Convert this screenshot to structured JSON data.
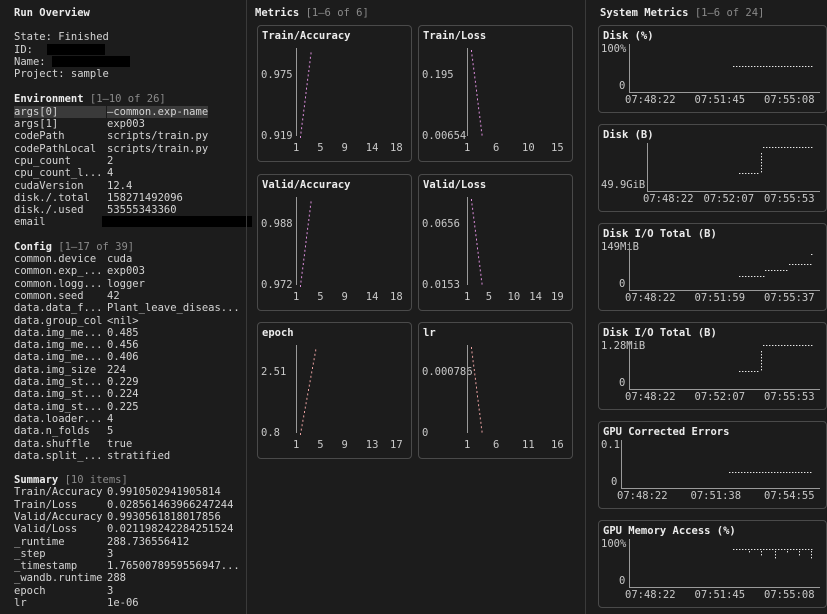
{
  "run_overview": {
    "title": "Run Overview",
    "state_label": "State:",
    "state_value": "Finished",
    "id_label": "ID:",
    "name_label": "Name:",
    "project_label": "Project:",
    "project_value": "sample"
  },
  "environment": {
    "title": "Environment",
    "range": "[1–10 of 26]",
    "rows": [
      {
        "key": "args[0]",
        "value": "—common.exp-name"
      },
      {
        "key": "args[1]",
        "value": "exp003"
      },
      {
        "key": "codePath",
        "value": "scripts/train.py"
      },
      {
        "key": "codePathLocal",
        "value": "scripts/train.py"
      },
      {
        "key": "cpu_count",
        "value": "2"
      },
      {
        "key": "cpu_count_l...",
        "value": "4"
      },
      {
        "key": "cudaVersion",
        "value": "12.4"
      },
      {
        "key": "disk./.total",
        "value": "158271492096"
      },
      {
        "key": "disk./.used",
        "value": "53555343360"
      },
      {
        "key": "email",
        "value": ""
      }
    ]
  },
  "config": {
    "title": "Config",
    "range": "[1–17 of 39]",
    "rows": [
      {
        "key": "common.device",
        "value": "cuda"
      },
      {
        "key": "common.exp_...",
        "value": "exp003"
      },
      {
        "key": "common.logg...",
        "value": "logger"
      },
      {
        "key": "common.seed",
        "value": "42"
      },
      {
        "key": "data.data_f...",
        "value": "Plant_leave_diseas..."
      },
      {
        "key": "data.group_col",
        "value": "<nil>"
      },
      {
        "key": "data.img_me...",
        "value": "0.485"
      },
      {
        "key": "data.img_me...",
        "value": "0.456"
      },
      {
        "key": "data.img_me...",
        "value": "0.406"
      },
      {
        "key": "data.img_size",
        "value": "224"
      },
      {
        "key": "data.img_st...",
        "value": "0.229"
      },
      {
        "key": "data.img_st...",
        "value": "0.224"
      },
      {
        "key": "data.img_st...",
        "value": "0.225"
      },
      {
        "key": "data.loader...",
        "value": "4"
      },
      {
        "key": "data.n_folds",
        "value": "5"
      },
      {
        "key": "data.shuffle",
        "value": "true"
      },
      {
        "key": "data.split_...",
        "value": "stratified"
      }
    ]
  },
  "summary": {
    "title": "Summary",
    "range": "[10 items]",
    "rows": [
      {
        "key": "Train/Accuracy",
        "value": "0.9910502941905814"
      },
      {
        "key": "Train/Loss",
        "value": "0.028561463966247244"
      },
      {
        "key": "Valid/Accuracy",
        "value": "0.9930561818017856"
      },
      {
        "key": "Valid/Loss",
        "value": "0.021198242284251524"
      },
      {
        "key": "_runtime",
        "value": "288.736556412"
      },
      {
        "key": "_step",
        "value": "3"
      },
      {
        "key": "_timestamp",
        "value": "1.7650078959556947..."
      },
      {
        "key": "_wandb.runtime",
        "value": "288"
      },
      {
        "key": "epoch",
        "value": "3"
      },
      {
        "key": "lr",
        "value": "1e-06"
      }
    ]
  },
  "metrics": {
    "title": "Metrics",
    "range": "[1–6 of 6]",
    "charts": [
      {
        "title": "Train/Accuracy",
        "ytop": "0.975",
        "ybot": "0.919",
        "xticks": [
          "1",
          "5",
          "9",
          "14",
          "18"
        ],
        "color": "#d98cd9"
      },
      {
        "title": "Train/Loss",
        "ytop": "0.195",
        "ybot": "0.00654",
        "xticks": [
          "1",
          "6",
          "10",
          "15"
        ],
        "color": "#d98cd9"
      },
      {
        "title": "Valid/Accuracy",
        "ytop": "0.988",
        "ybot": "0.972",
        "xticks": [
          "1",
          "5",
          "9",
          "14",
          "18"
        ],
        "color": "#d98cd9"
      },
      {
        "title": "Valid/Loss",
        "ytop": "0.0656",
        "ybot": "0.0153",
        "xticks": [
          "1",
          "5",
          "10",
          "14",
          "19"
        ],
        "color": "#d98cd9"
      },
      {
        "title": "epoch",
        "ytop": "2.51",
        "ybot": "0.8",
        "xticks": [
          "1",
          "5",
          "9",
          "13",
          "17"
        ],
        "color": "#e8a0a0"
      },
      {
        "title": "lr",
        "ytop": "0.000786",
        "ybot": "0",
        "xticks": [
          "1",
          "6",
          "11",
          "16"
        ],
        "color": "#e8a0a0"
      }
    ]
  },
  "system": {
    "title": "System Metrics",
    "range": "[1–6 of 24]",
    "charts": [
      {
        "title": "Disk (%)",
        "ytop": "100%",
        "ybot": "0",
        "xticks": [
          "07:48:22",
          "07:51:45",
          "07:55:08"
        ],
        "color": "#e8e8e8",
        "shape": "flat_high"
      },
      {
        "title": "Disk (B)",
        "ytop": "",
        "ybot": "49.9GiB",
        "xticks": [
          "07:48:22",
          "07:52:07",
          "07:55:53"
        ],
        "color": "#e8e8e8",
        "shape": "step_up"
      },
      {
        "title": "Disk I/O Total (B)",
        "ytop": "149MiB",
        "ybot": "0",
        "xticks": [
          "07:48:22",
          "07:51:59",
          "07:55:37"
        ],
        "color": "#e8e8e8",
        "shape": "stairs"
      },
      {
        "title": "Disk I/O Total (B)",
        "ytop": "1.28MiB",
        "ybot": "0",
        "xticks": [
          "07:48:22",
          "07:52:07",
          "07:55:53"
        ],
        "color": "#e8e8e8",
        "shape": "step_up"
      },
      {
        "title": "GPU Corrected Errors",
        "ytop": "0.1",
        "ybot": "0",
        "xticks": [
          "07:48:22",
          "07:51:38",
          "07:54:55"
        ],
        "color": "#e8e8e8",
        "shape": "flat_low"
      },
      {
        "title": "GPU Memory Access (%)",
        "ytop": "100%",
        "ybot": "0",
        "xticks": [
          "07:48:22",
          "07:51:45",
          "07:55:08"
        ],
        "color": "#e8e8e8",
        "shape": "noisy_high"
      }
    ]
  }
}
